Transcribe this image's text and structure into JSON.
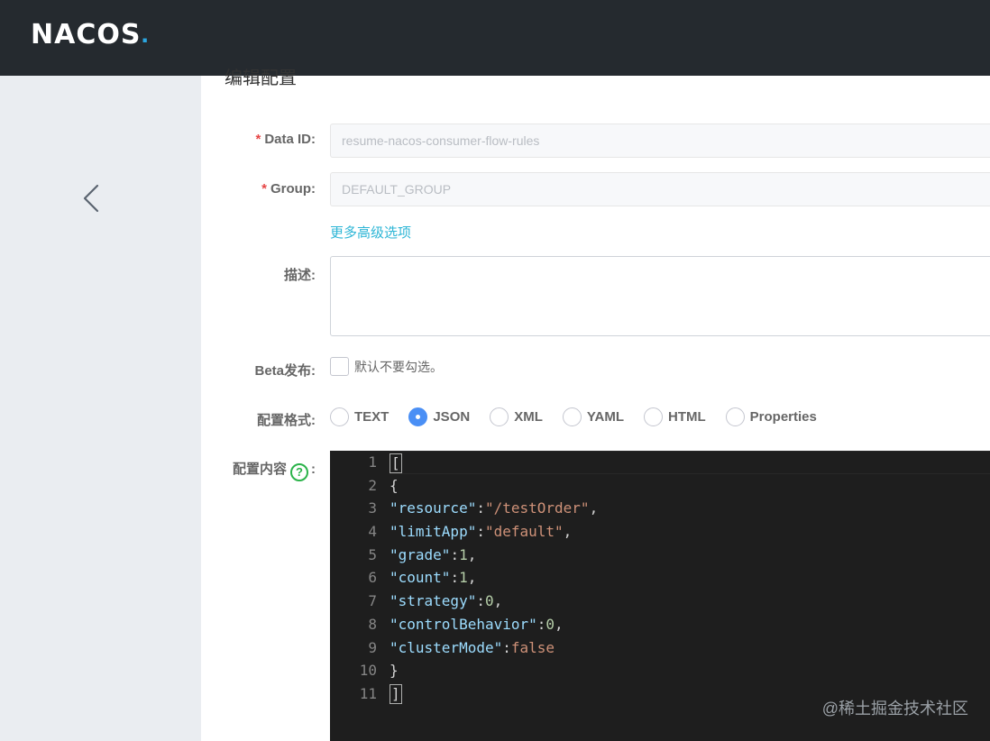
{
  "header": {
    "logo_text": "NACOS",
    "logo_dot": "."
  },
  "page": {
    "title": "编辑配置"
  },
  "form": {
    "data_id": {
      "required_mark": "*",
      "label": "Data ID:",
      "value": "resume-nacos-consumer-flow-rules"
    },
    "group": {
      "required_mark": "*",
      "label": "Group:",
      "value": "DEFAULT_GROUP"
    },
    "advanced_link": "更多高级选项",
    "description": {
      "label": "描述:",
      "value": ""
    },
    "beta": {
      "label": "Beta发布:",
      "checkbox_text": "默认不要勾选。",
      "checked": false
    },
    "format": {
      "label": "配置格式:",
      "options": [
        "TEXT",
        "JSON",
        "XML",
        "YAML",
        "HTML",
        "Properties"
      ],
      "selected": "JSON"
    },
    "content": {
      "label": "配置内容",
      "help_icon": "question-circle-icon",
      "colon": ":"
    }
  },
  "editor": {
    "line_numbers": [
      "1",
      "2",
      "3",
      "4",
      "5",
      "6",
      "7",
      "8",
      "9",
      "10",
      "11"
    ],
    "lines": [
      [
        {
          "t": "[",
          "c": "pun",
          "cursor": true
        }
      ],
      [
        {
          "t": "{",
          "c": "pun"
        }
      ],
      [
        {
          "t": "\"resource\"",
          "c": "key"
        },
        {
          "t": ":",
          "c": "pun"
        },
        {
          "t": "\"/testOrder\"",
          "c": "str"
        },
        {
          "t": ",",
          "c": "pun"
        }
      ],
      [
        {
          "t": "\"limitApp\"",
          "c": "key"
        },
        {
          "t": ":",
          "c": "pun"
        },
        {
          "t": "\"default\"",
          "c": "str"
        },
        {
          "t": ",",
          "c": "pun"
        }
      ],
      [
        {
          "t": "\"grade\"",
          "c": "key"
        },
        {
          "t": ":",
          "c": "pun"
        },
        {
          "t": "1",
          "c": "num"
        },
        {
          "t": ",",
          "c": "pun"
        }
      ],
      [
        {
          "t": "\"count\"",
          "c": "key"
        },
        {
          "t": ":",
          "c": "pun"
        },
        {
          "t": "1",
          "c": "num"
        },
        {
          "t": ",",
          "c": "pun"
        }
      ],
      [
        {
          "t": "\"strategy\"",
          "c": "key"
        },
        {
          "t": ":",
          "c": "pun"
        },
        {
          "t": "0",
          "c": "num"
        },
        {
          "t": ",",
          "c": "pun"
        }
      ],
      [
        {
          "t": "\"controlBehavior\"",
          "c": "key"
        },
        {
          "t": ":",
          "c": "pun"
        },
        {
          "t": "0",
          "c": "num"
        },
        {
          "t": ",",
          "c": "pun"
        }
      ],
      [
        {
          "t": "\"clusterMode\"",
          "c": "key"
        },
        {
          "t": ":",
          "c": "pun"
        },
        {
          "t": "false",
          "c": "bool"
        }
      ],
      [
        {
          "t": "}",
          "c": "pun"
        }
      ],
      [
        {
          "t": "]",
          "c": "pun",
          "cursor": true
        }
      ]
    ]
  },
  "watermark": "@稀土掘金技术社区",
  "colors": {
    "topbar": "#252a2f",
    "sidebar": "#eaedf1",
    "editor_bg": "#1e1e1e",
    "accent": "#4a8ff5",
    "link": "#2eb6d6",
    "required": "#e64545",
    "help": "#2bb34a"
  }
}
